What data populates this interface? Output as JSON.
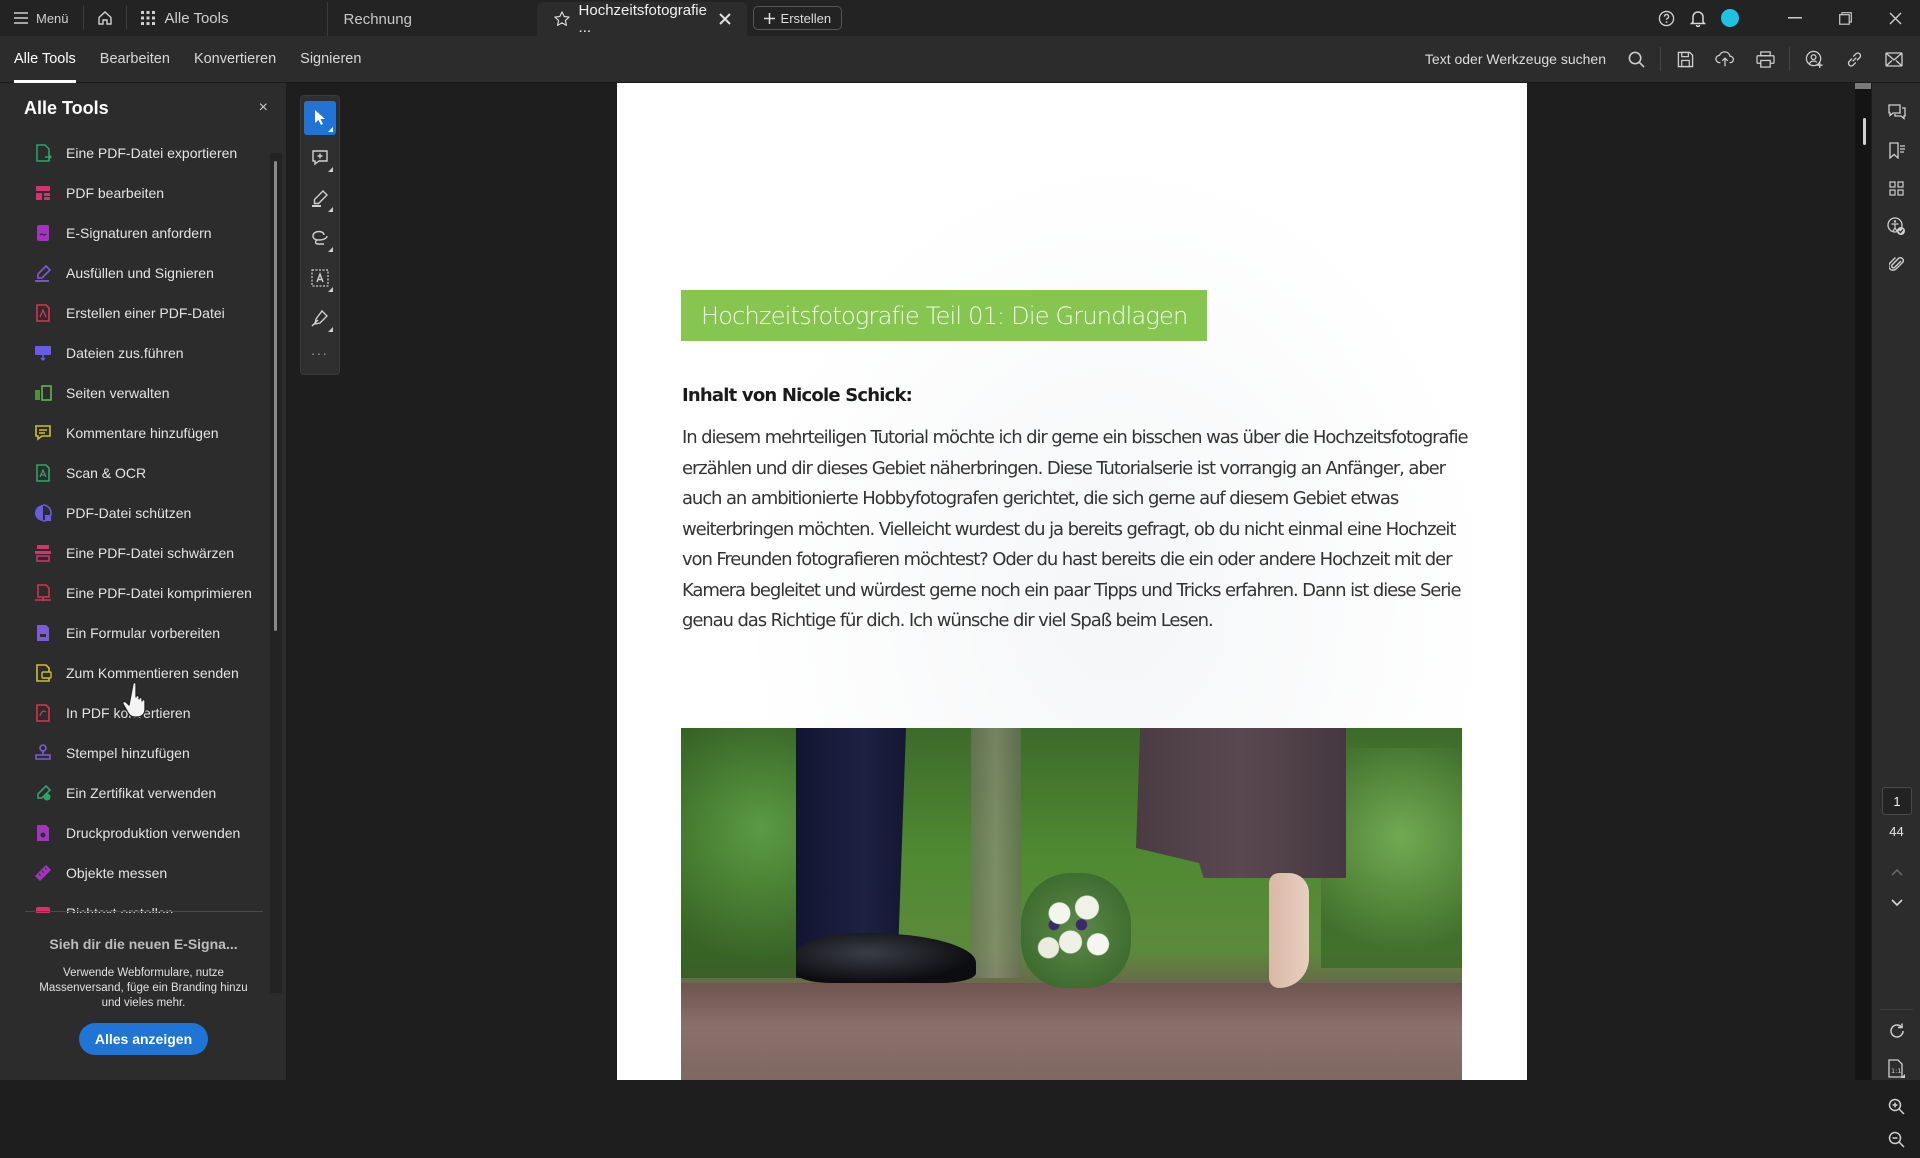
{
  "titlebar": {
    "menu_label": "Menü",
    "all_tools_tab": "Alle Tools",
    "tabs": [
      {
        "label": "Rechnung"
      },
      {
        "label": "Hochzeitsfotografie ..."
      }
    ],
    "create_label": "Erstellen"
  },
  "toolbar": {
    "menu_tabs": [
      "Alle Tools",
      "Bearbeiten",
      "Konvertieren",
      "Signieren"
    ],
    "active_tab": "Alle Tools",
    "search_label": "Text oder Werkzeuge suchen"
  },
  "sidebar": {
    "title": "Alle Tools",
    "close_label": "×",
    "items": [
      {
        "label": "Eine PDF-Datei exportieren",
        "icon": "export-pdf-icon",
        "color": "#2fa36b"
      },
      {
        "label": "PDF bearbeiten",
        "icon": "edit-pdf-icon",
        "color": "#d6336c"
      },
      {
        "label": "E-Signaturen anfordern",
        "icon": "request-esign-icon",
        "color": "#a433c2"
      },
      {
        "label": "Ausfüllen und Signieren",
        "icon": "fill-sign-icon",
        "color": "#7c5cd6"
      },
      {
        "label": "Erstellen einer PDF-Datei",
        "icon": "create-pdf-icon",
        "color": "#d63450"
      },
      {
        "label": "Dateien zus.führen",
        "icon": "combine-files-icon",
        "color": "#6a5ce0"
      },
      {
        "label": "Seiten verwalten",
        "icon": "organize-pages-icon",
        "color": "#5fb84a"
      },
      {
        "label": "Kommentare hinzufügen",
        "icon": "add-comment-icon",
        "color": "#c9c22a"
      },
      {
        "label": "Scan & OCR",
        "icon": "scan-ocr-icon",
        "color": "#2fa36b"
      },
      {
        "label": "PDF-Datei schützen",
        "icon": "protect-pdf-icon",
        "color": "#6a5ce0"
      },
      {
        "label": "Eine PDF-Datei schwärzen",
        "icon": "redact-pdf-icon",
        "color": "#d6336c"
      },
      {
        "label": "Eine PDF-Datei komprimieren",
        "icon": "compress-pdf-icon",
        "color": "#d63450"
      },
      {
        "label": "Ein Formular vorbereiten",
        "icon": "prepare-form-icon",
        "color": "#7c5cd6"
      },
      {
        "label": "Zum Kommentieren senden",
        "icon": "send-for-comments-icon",
        "color": "#c9c22a"
      },
      {
        "label": "In PDF konvertieren",
        "icon": "convert-to-pdf-icon",
        "color": "#d63450"
      },
      {
        "label": "Stempel hinzufügen",
        "icon": "stamp-icon",
        "color": "#7c5cd6"
      },
      {
        "label": "Ein Zertifikat verwenden",
        "icon": "certificate-icon",
        "color": "#2fa36b"
      },
      {
        "label": "Druckproduktion verwenden",
        "icon": "print-production-icon",
        "color": "#a433c2"
      },
      {
        "label": "Objekte messen",
        "icon": "measure-icon",
        "color": "#a433c2"
      },
      {
        "label": "Richtext erstellen",
        "icon": "more-tool-icon",
        "color": "#d6336c"
      }
    ],
    "promo": {
      "title": "Sieh dir die neuen E-Signa...",
      "text": "Verwende Webformulare, nutze Massenversand, füge ein Branding hinzu und vieles mehr.",
      "button": "Alles anzeigen"
    }
  },
  "quick_tools": [
    "select-tool",
    "add-comment-tool",
    "highlight-tool",
    "draw-tool",
    "text-recognition-tool",
    "sign-tool"
  ],
  "quick_tools_more": "...",
  "document": {
    "title": "Hochzeitsfotografie Teil 01: Die Grundlagen",
    "title_bg": "#86c550",
    "author": "Inhalt von Nicole Schick:",
    "body": "In diesem mehrteiligen Tutorial möchte ich dir gerne ein bisschen was über die Hochzeitsfotografie erzählen und dir dieses Gebiet näherbringen. Diese Tutorialserie ist vorrangig an Anfänger, aber auch an ambitionierte Hobbyfotografen gerichtet, die sich gerne auf diesem Gebiet etwas weiterbringen möchten. Vielleicht wurdest du ja bereits gefragt, ob du nicht einmal eine Hochzeit von Freunden fotografieren möchtest? Oder du hast bereits die ein oder andere Hochzeit mit der Kamera begleitet und würdest gerne noch ein paar Tipps und Tricks erfahren. Dann ist diese Serie genau das Richtige für dich. Ich wünsche dir viel Spaß beim Lesen.",
    "image_description": "Wedding photo: groom's shoes, bride on tiptoe, bouquet on path"
  },
  "pagination": {
    "current_page": "1",
    "total_pages": "44"
  },
  "colors": {
    "accent": "#1f74d6",
    "avatar": "#1fc3e0"
  }
}
